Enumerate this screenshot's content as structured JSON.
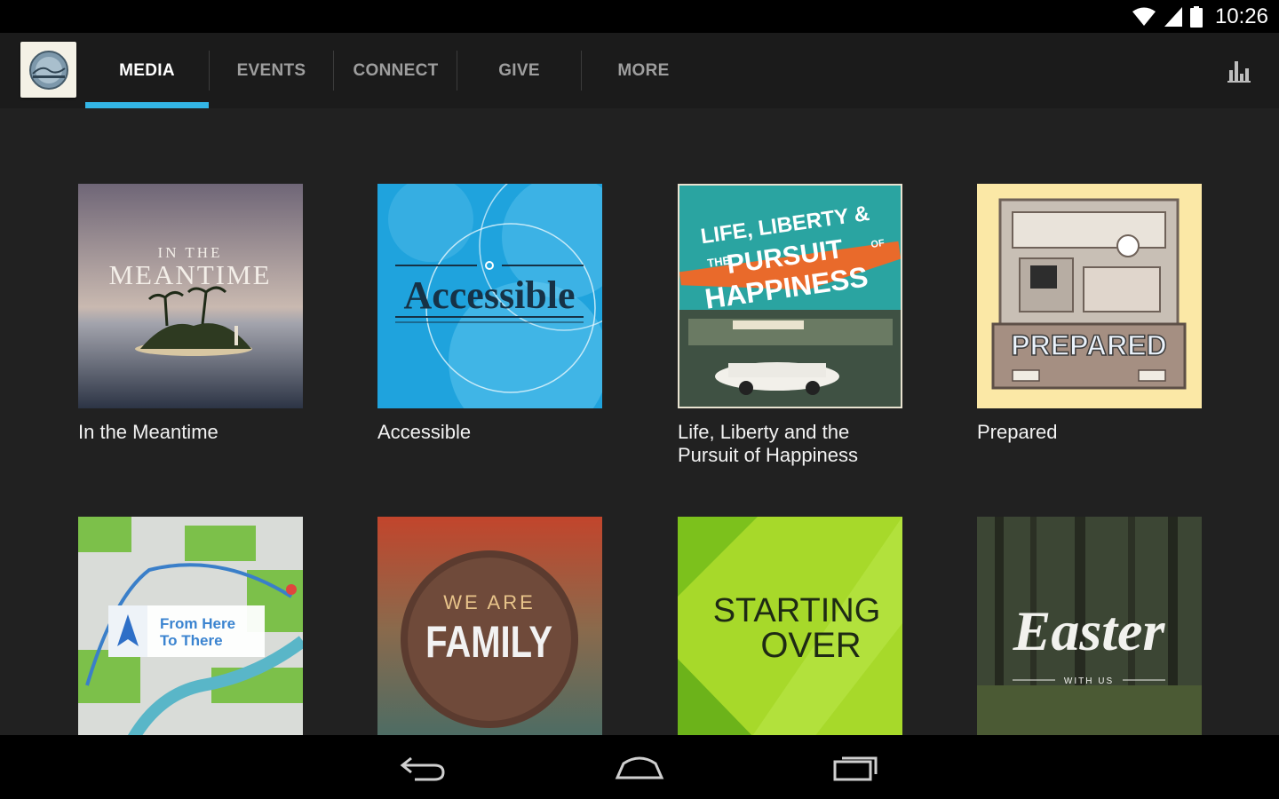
{
  "status_bar": {
    "time": "10:26",
    "icons": [
      "wifi-icon",
      "signal-icon",
      "battery-icon"
    ]
  },
  "app": {
    "logo_icon": "church-logo-icon",
    "tabs": [
      {
        "label": "MEDIA",
        "active": true
      },
      {
        "label": "EVENTS",
        "active": false
      },
      {
        "label": "CONNECT",
        "active": false
      },
      {
        "label": "GIVE",
        "active": false
      },
      {
        "label": "MORE",
        "active": false
      }
    ],
    "overflow_icon": "bar-chart-icon"
  },
  "media": [
    {
      "title": "In the Meantime",
      "art_text": [
        "IN THE",
        "MEANTIME"
      ]
    },
    {
      "title": "Accessible",
      "art_text": [
        "Accessible"
      ]
    },
    {
      "title": "Life, Liberty and the Pursuit of Happiness",
      "art_text": [
        "LIFE, LIBERTY &",
        "THE",
        "PURSUIT",
        "OF",
        "HAPPINESS"
      ]
    },
    {
      "title": "Prepared",
      "art_text": [
        "PREPARED"
      ]
    },
    {
      "title": "",
      "art_text": [
        "From Here",
        "To There"
      ]
    },
    {
      "title": "",
      "art_text": [
        "WE ARE",
        "FAMILY"
      ]
    },
    {
      "title": "",
      "art_text": [
        "STARTING",
        "OVER"
      ]
    },
    {
      "title": "",
      "art_text": [
        "Easter",
        "WITH US"
      ]
    }
  ],
  "nav_bar": {
    "icons": [
      "back-icon",
      "home-icon",
      "recent-apps-icon"
    ]
  },
  "colors": {
    "accent": "#33b5e5",
    "background": "#212121",
    "action_bar": "#1b1b1b"
  }
}
